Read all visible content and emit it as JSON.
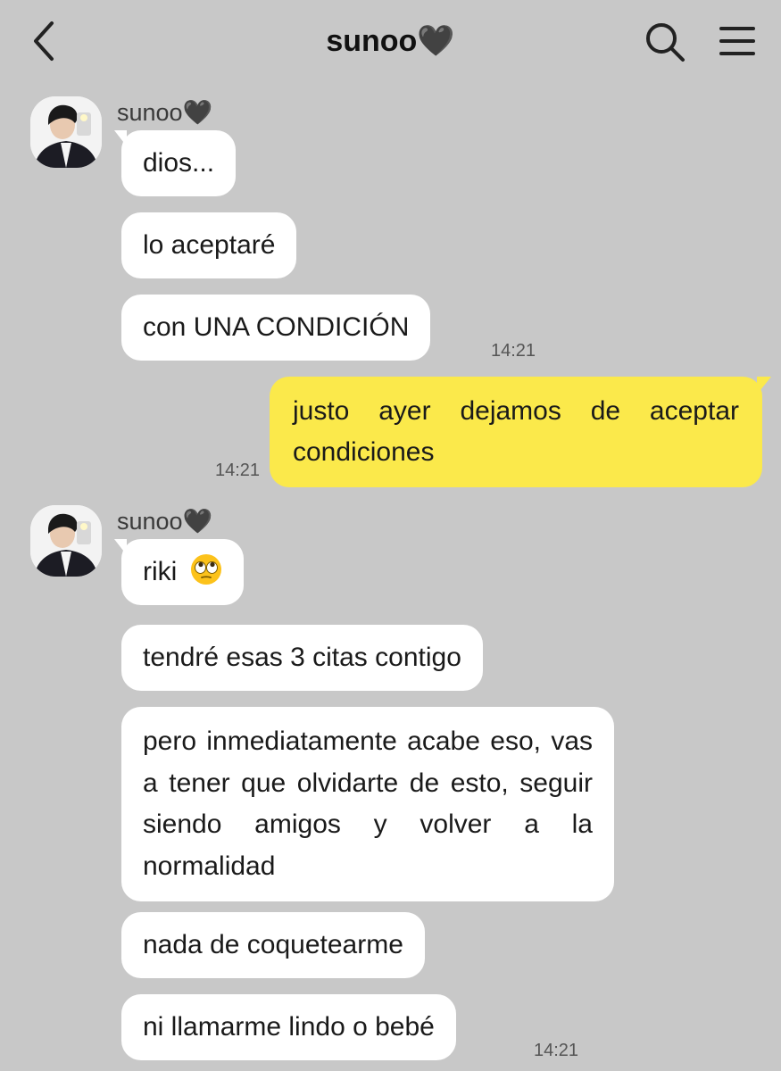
{
  "header": {
    "title": "sunoo🖤",
    "back_icon": "chevron-left-icon",
    "search_icon": "search-icon",
    "menu_icon": "hamburger-menu-icon"
  },
  "messages": {
    "group1": {
      "sender": "sunoo🖤",
      "m1": "dios...",
      "m2": "lo aceptaré",
      "m3": "con UNA CONDICIÓN",
      "time": "14:21"
    },
    "mine1": {
      "text": "justo ayer dejamos de aceptar condiciones",
      "time": "14:21"
    },
    "group2": {
      "sender": "sunoo🖤",
      "m1": "riki",
      "m1_emoji": "eye-roll-emoji",
      "m2": "tendré esas 3 citas contigo",
      "m3": "pero inmediatamente acabe eso, vas a tener que olvidarte de esto, seguir siendo amigos y volver a la normalidad",
      "m4": "nada de coquetearme",
      "m5": "ni llamarme lindo o bebé",
      "time": "14:21"
    }
  },
  "colors": {
    "background": "#c8c8c8",
    "incoming_bubble": "#ffffff",
    "outgoing_bubble": "#fbe94b"
  }
}
